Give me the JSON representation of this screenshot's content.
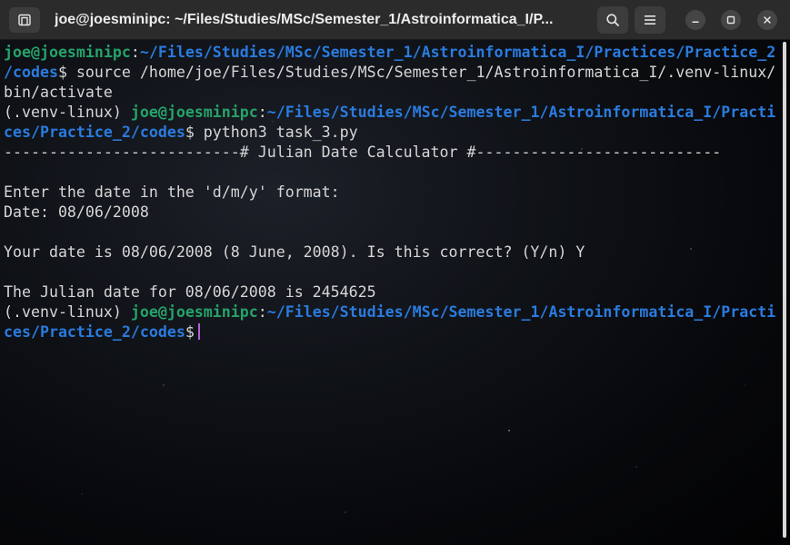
{
  "window": {
    "title": "joe@joesminipc: ~/Files/Studies/MSc/Semester_1/Astroinformatica_I/P..."
  },
  "titlebar_icons": {
    "new_tab": "new-tab-icon",
    "search": "search-icon",
    "menu": "hamburger-menu-icon",
    "minimize": "minimize-icon",
    "maximize": "maximize-icon",
    "close": "close-icon"
  },
  "colors": {
    "user_host": "#26a269",
    "path": "#2a7bde",
    "text": "#d6d6d6",
    "cursor": "#b55fd8",
    "titlebar": "#2b2b2b"
  },
  "terminal": {
    "lines": [
      {
        "segments": [
          {
            "t": "joe@joesminipc",
            "c": "u"
          },
          {
            "t": ":",
            "c": ""
          },
          {
            "t": "~/Files/Studies/MSc/Semester_1/Astroinformatica_I/Practices/Practice_2",
            "c": "p"
          }
        ]
      },
      {
        "segments": [
          {
            "t": "/codes",
            "c": "p"
          },
          {
            "t": "$ source /home/joe/Files/Studies/MSc/Semester_1/Astroinformatica_I/.venv-linux/",
            "c": ""
          }
        ]
      },
      {
        "segments": [
          {
            "t": "bin/activate",
            "c": ""
          }
        ]
      },
      {
        "segments": [
          {
            "t": "(.venv-linux) ",
            "c": ""
          },
          {
            "t": "joe@joesminipc",
            "c": "u"
          },
          {
            "t": ":",
            "c": ""
          },
          {
            "t": "~/Files/Studies/MSc/Semester_1/Astroinformatica_I/Practi",
            "c": "p"
          }
        ]
      },
      {
        "segments": [
          {
            "t": "ces/Practice_2/codes",
            "c": "p"
          },
          {
            "t": "$ python3 task_3.py",
            "c": ""
          }
        ]
      },
      {
        "segments": [
          {
            "t": "--------------------------# Julian Date Calculator #---------------------------",
            "c": ""
          }
        ]
      },
      {
        "segments": []
      },
      {
        "segments": [
          {
            "t": "Enter the date in the 'd/m/y' format:",
            "c": ""
          }
        ]
      },
      {
        "segments": [
          {
            "t": "Date: 08/06/2008",
            "c": ""
          }
        ]
      },
      {
        "segments": []
      },
      {
        "segments": [
          {
            "t": "Your date is 08/06/2008 (8 June, 2008). Is this correct? (Y/n) Y",
            "c": ""
          }
        ]
      },
      {
        "segments": []
      },
      {
        "segments": [
          {
            "t": "The Julian date for 08/06/2008 is 2454625",
            "c": ""
          }
        ]
      },
      {
        "segments": [
          {
            "t": "(.venv-linux) ",
            "c": ""
          },
          {
            "t": "joe@joesminipc",
            "c": "u"
          },
          {
            "t": ":",
            "c": ""
          },
          {
            "t": "~/Files/Studies/MSc/Semester_1/Astroinformatica_I/Practi",
            "c": "p"
          }
        ]
      },
      {
        "segments": [
          {
            "t": "ces/Practice_2/codes",
            "c": "p"
          },
          {
            "t": "$",
            "c": ""
          }
        ],
        "cursor": true
      }
    ]
  }
}
